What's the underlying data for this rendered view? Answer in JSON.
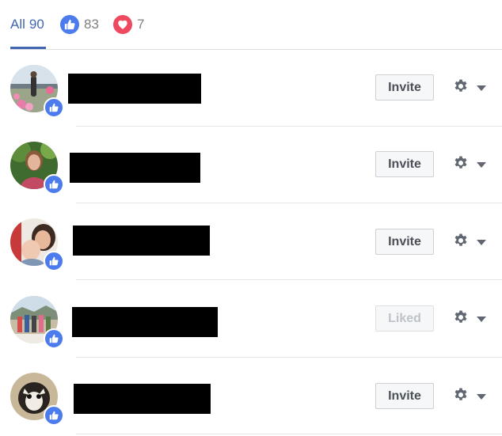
{
  "tabs": {
    "all": {
      "label": "All",
      "count": "90"
    },
    "like": {
      "icon": "thumbs-up-icon",
      "count": "83"
    },
    "love": {
      "icon": "heart-icon",
      "count": "7"
    }
  },
  "colors": {
    "accent": "#4267b2",
    "like": "#4b7bec",
    "love": "#ee4a5f"
  },
  "rows": [
    {
      "reaction": "like",
      "name_redacted": true,
      "action": "Invite",
      "action_enabled": true
    },
    {
      "reaction": "like",
      "name_redacted": true,
      "action": "Invite",
      "action_enabled": true
    },
    {
      "reaction": "like",
      "name_redacted": true,
      "action": "Invite",
      "action_enabled": true
    },
    {
      "reaction": "like",
      "name_redacted": true,
      "action": "Liked",
      "action_enabled": false
    },
    {
      "reaction": "like",
      "name_redacted": true,
      "action": "Invite",
      "action_enabled": true
    }
  ]
}
